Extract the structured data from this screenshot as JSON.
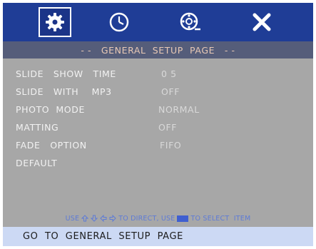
{
  "icons": [
    {
      "name": "gear-icon",
      "selected": true
    },
    {
      "name": "clock-icon",
      "selected": false
    },
    {
      "name": "photo-settings-icon",
      "selected": false
    },
    {
      "name": "close-icon",
      "selected": false
    }
  ],
  "title": "- -   GENERAL  SETUP  PAGE   - -",
  "menu": [
    {
      "label": "SLIDE   SHOW   TIME",
      "value": "0 5"
    },
    {
      "label": "SLIDE   WITH    MP3",
      "value": "OFF"
    },
    {
      "label": "PHOTO  MODE",
      "value": "NORMAL"
    },
    {
      "label": "MATTING",
      "value": "OFF"
    },
    {
      "label": "FADE   OPTION",
      "value": "FIFO"
    },
    {
      "label": "DEFAULT",
      "value": ""
    }
  ],
  "hint": {
    "prefix": "USE",
    "middle": "TO DIRECT, USE",
    "suffix": "TO SELECT  ITEM"
  },
  "status": "GO  TO  GENERAL  SETUP  PAGE",
  "colors": {
    "iconbar": "#1f3d96",
    "titlebar": "#555d7a",
    "background": "#a7a7a7",
    "statusbar": "#ccd9f4",
    "hint": "#5e7bd6"
  }
}
